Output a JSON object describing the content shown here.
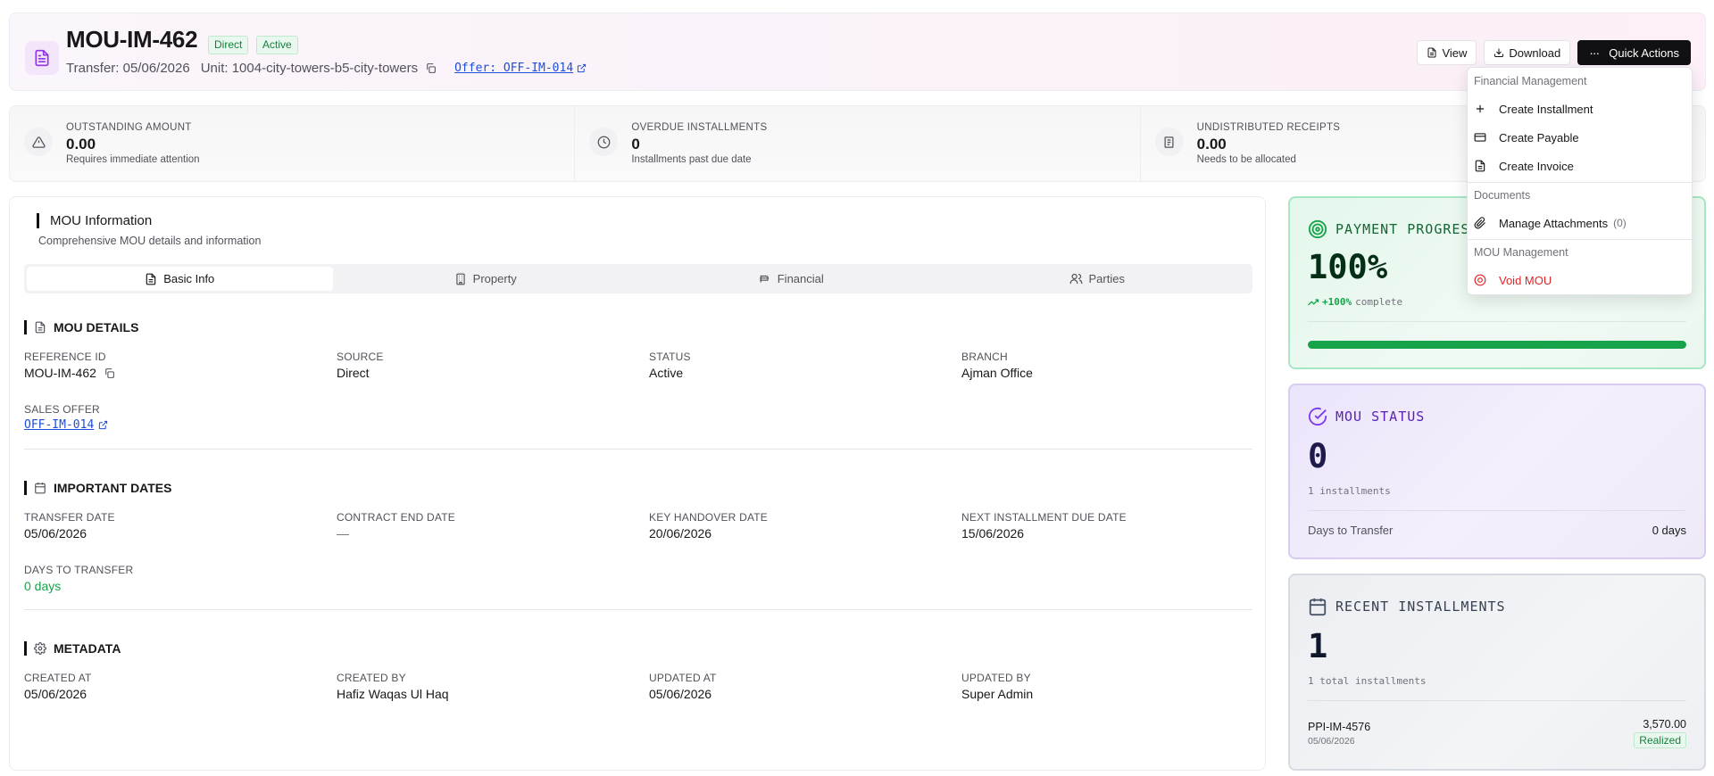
{
  "header": {
    "title": "MOU-IM-462",
    "badges": {
      "source": "Direct",
      "status": "Active"
    },
    "transfer_label": "Transfer: 05/06/2026",
    "unit_label": "Unit: 1004-city-towers-b5-city-towers",
    "offer_link": "Offer: OFF-IM-014",
    "buttons": {
      "view": "View",
      "download": "Download",
      "quick_actions": "Quick Actions"
    }
  },
  "stats": [
    {
      "label": "OUTSTANDING AMOUNT",
      "value": "0.00",
      "sub": "Requires immediate attention",
      "icon": "alert-triangle-icon"
    },
    {
      "label": "OVERDUE INSTALLMENTS",
      "value": "0",
      "sub": "Installments past due date",
      "icon": "clock-icon"
    },
    {
      "label": "UNDISTRIBUTED RECEIPTS",
      "value": "0.00",
      "sub": "Needs to be allocated",
      "icon": "receipt-icon"
    }
  ],
  "main": {
    "title": "MOU Information",
    "description": "Comprehensive MOU details and information",
    "tabs": [
      "Basic Info",
      "Property",
      "Financial",
      "Parties"
    ],
    "details": {
      "heading": "MOU DETAILS",
      "reference_label": "REFERENCE ID",
      "reference_value": "MOU-IM-462",
      "source_label": "SOURCE",
      "source_value": "Direct",
      "status_label": "STATUS",
      "status_value": "Active",
      "branch_label": "BRANCH",
      "branch_value": "Ajman Office",
      "offer_label": "SALES OFFER",
      "offer_value": "OFF-IM-014"
    },
    "dates": {
      "heading": "IMPORTANT DATES",
      "transfer_label": "TRANSFER DATE",
      "transfer_value": "05/06/2026",
      "contract_end_label": "CONTRACT END DATE",
      "contract_end_value": "—",
      "handover_label": "KEY HANDOVER DATE",
      "handover_value": "20/06/2026",
      "next_due_label": "NEXT INSTALLMENT DUE DATE",
      "next_due_value": "15/06/2026",
      "days_label": "DAYS TO TRANSFER",
      "days_value": "0 days"
    },
    "metadata": {
      "heading": "METADATA",
      "created_at_label": "CREATED AT",
      "created_at_value": "05/06/2026",
      "created_by_label": "CREATED BY",
      "created_by_value": "Hafiz Waqas Ul Haq",
      "updated_at_label": "UPDATED AT",
      "updated_at_value": "05/06/2026",
      "updated_by_label": "UPDATED BY",
      "updated_by_value": "Super Admin"
    }
  },
  "payment": {
    "title": "PAYMENT PROGRESS",
    "percent": "100%",
    "trend": "+100%",
    "trend_suffix": "complete",
    "progress": 1.0
  },
  "mou_status": {
    "title": "MOU STATUS",
    "value": "0",
    "sub": "1 installments",
    "row_label": "Days to Transfer",
    "row_value": "0 days"
  },
  "recent": {
    "title": "RECENT INSTALLMENTS",
    "value": "1",
    "sub": "1 total installments",
    "item": {
      "id": "PPI-IM-4576",
      "date": "05/06/2026",
      "amount": "3,570.00",
      "status": "Realized"
    }
  },
  "menu": {
    "group_financial": "Financial Management",
    "create_installment": "Create Installment",
    "create_payable": "Create Payable",
    "create_invoice": "Create Invoice",
    "group_documents": "Documents",
    "manage_attachments": "Manage Attachments",
    "attachments_count": "(0)",
    "group_mou": "MOU Management",
    "void_mou": "Void MOU"
  },
  "colors": {
    "green": "#16a34a",
    "purple": "#9333ea",
    "red": "#dc2626",
    "link": "#1d4ed8"
  }
}
